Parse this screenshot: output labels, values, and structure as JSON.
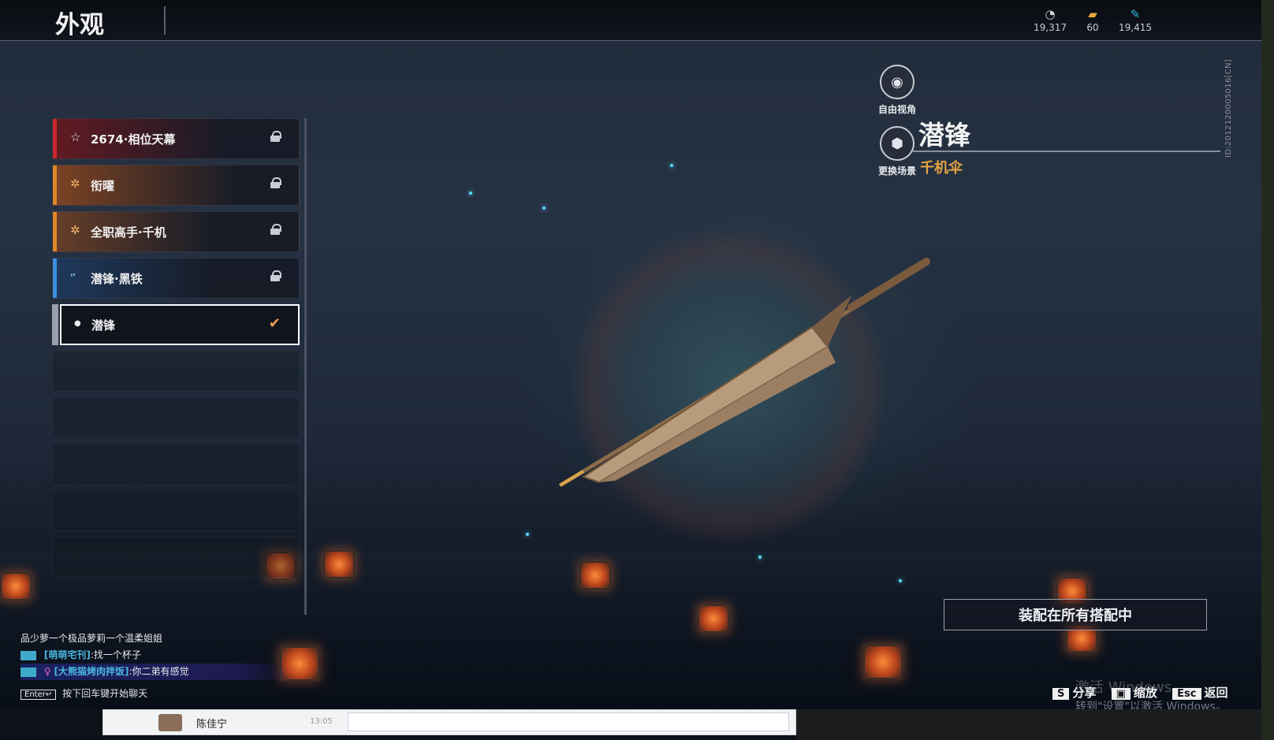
{
  "header": {
    "title": "外观",
    "currencies": [
      {
        "icon": "coin-icon",
        "glyph": "◔",
        "value": "19,317"
      },
      {
        "icon": "ticket-icon",
        "glyph": "▰",
        "value": "60"
      },
      {
        "icon": "feather-icon",
        "glyph": "✎",
        "value": "19,415"
      }
    ]
  },
  "skin_list": {
    "items": [
      {
        "label": "2674·相位天幕",
        "glyph": "☆",
        "accent": "#c8282e",
        "locked": true
      },
      {
        "label": "衔曜",
        "glyph": "✲",
        "accent": "#e0862a",
        "locked": true
      },
      {
        "label": "全职高手·千机",
        "glyph": "✲",
        "accent": "#e0862a",
        "locked": true
      },
      {
        "label": "潜锋·黑铁",
        "glyph": "❛❜",
        "accent": "#3d8fe0",
        "locked": true
      },
      {
        "label": "潜锋",
        "glyph": "●",
        "accent": "#9aa0ac",
        "locked": false,
        "selected": true
      }
    ]
  },
  "actions": {
    "free_view": "自由视角",
    "change_scene": "更换场景"
  },
  "item": {
    "name": "潜锋",
    "type": "千机伞",
    "id_text": "ID:2012120005016[CN]"
  },
  "equip_button": "装配在所有搭配中",
  "chat": {
    "lines": [
      {
        "speaker": "",
        "text": "品少萝一个极品萝莉一个温柔姐姐"
      },
      {
        "speaker": "[萌萌宅刊]",
        "text": ":找一个杯子"
      },
      {
        "speaker": "[大熊猫烤肉拌饭]",
        "text": ":你二弟有感觉"
      }
    ],
    "hint_key": "Enter↵",
    "hint": "按下回车键开始聊天"
  },
  "shortcuts": [
    {
      "key": "S",
      "label": "分享"
    },
    {
      "key": "▣",
      "label": "缩放"
    },
    {
      "key": "Esc",
      "label": "返回"
    }
  ],
  "watermark": {
    "line1": "激活 Windows",
    "line2": "转到\"设置\"以激活 Windows。"
  },
  "taskbar": {
    "contact_name": "陈佳宁",
    "contact_time": "13:05"
  }
}
